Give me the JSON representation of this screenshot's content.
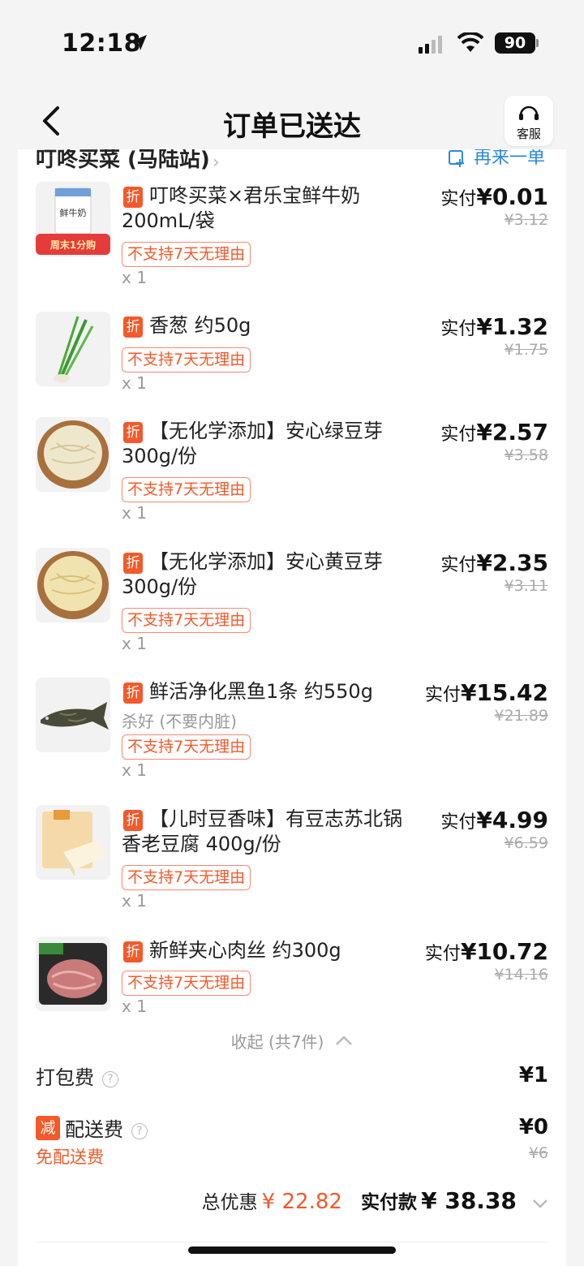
{
  "status_bar": {
    "time": "12:18",
    "battery": "90"
  },
  "nav": {
    "title": "订单已送达",
    "customer_service": "客服"
  },
  "store": {
    "name": "叮咚买菜 (马陆站)",
    "reorder": "再来一单"
  },
  "labels": {
    "paid_prefix": "实付",
    "no_return_tag": "不支持7天无理由",
    "discount_badge": "折"
  },
  "items": [
    {
      "name": "叮咚买菜×君乐宝鲜牛奶200mL/袋",
      "qty": "x 1",
      "paid": "¥0.01",
      "original": "¥3.12",
      "thumb": "milk"
    },
    {
      "name": "香葱 约50g",
      "qty": "x 1",
      "paid": "¥1.32",
      "original": "¥1.75",
      "thumb": "scallion"
    },
    {
      "name": "【无化学添加】安心绿豆芽 300g/份",
      "qty": "x 1",
      "paid": "¥2.57",
      "original": "¥3.58",
      "thumb": "sprouts"
    },
    {
      "name": "【无化学添加】安心黄豆芽 300g/份",
      "qty": "x 1",
      "paid": "¥2.35",
      "original": "¥3.11",
      "thumb": "sprouts"
    },
    {
      "name": "鲜活净化黑鱼1条 约550g",
      "sub": "杀好 (不要内脏)",
      "qty": "x 1",
      "paid": "¥15.42",
      "original": "¥21.89",
      "thumb": "fish"
    },
    {
      "name": "【儿时豆香味】有豆志苏北锅香老豆腐 400g/份",
      "qty": "x 1",
      "paid": "¥4.99",
      "original": "¥6.59",
      "thumb": "tofu"
    },
    {
      "name": "新鲜夹心肉丝 约300g",
      "qty": "x 1",
      "paid": "¥10.72",
      "original": "¥14.16",
      "thumb": "pork"
    }
  ],
  "collapse": "收起 (共7件)",
  "fees": {
    "packing_label": "打包费",
    "packing_value": "¥1",
    "delivery_badge": "减",
    "delivery_label": "配送费",
    "delivery_value": "¥0",
    "delivery_original": "¥6",
    "free_delivery": "免配送费"
  },
  "total": {
    "discount_label": "总优惠",
    "discount_value": "¥ 22.82",
    "paid_label": "实付款",
    "paid_value": "¥ 38.38"
  },
  "colors": {
    "accent": "#f4592a",
    "link": "#2b8ad8"
  }
}
